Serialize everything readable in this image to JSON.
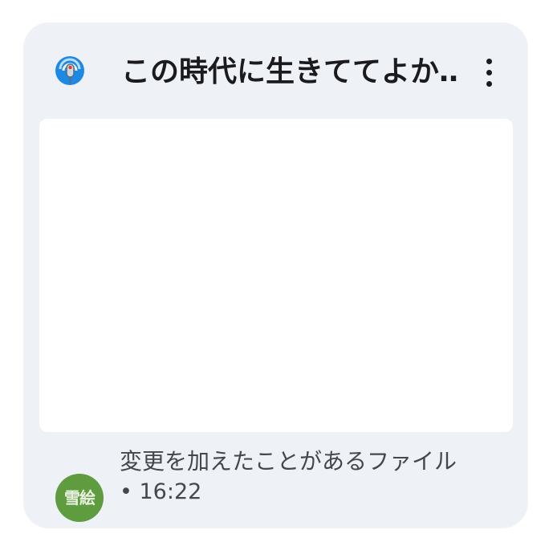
{
  "card": {
    "title": "この時代に生きててよか…",
    "app_icon": "podcast-microphone-icon",
    "menu_icon": "more-vert-icon"
  },
  "footer": {
    "avatar_text": "雪絵",
    "activity_text": "変更を加えたことがあるファイル",
    "timestamp": "• 16:22"
  },
  "colors": {
    "card_background": "#eef2f7",
    "avatar_background": "#5f9b3f",
    "title_text": "#1b1b1f",
    "secondary_text": "#44474e"
  }
}
